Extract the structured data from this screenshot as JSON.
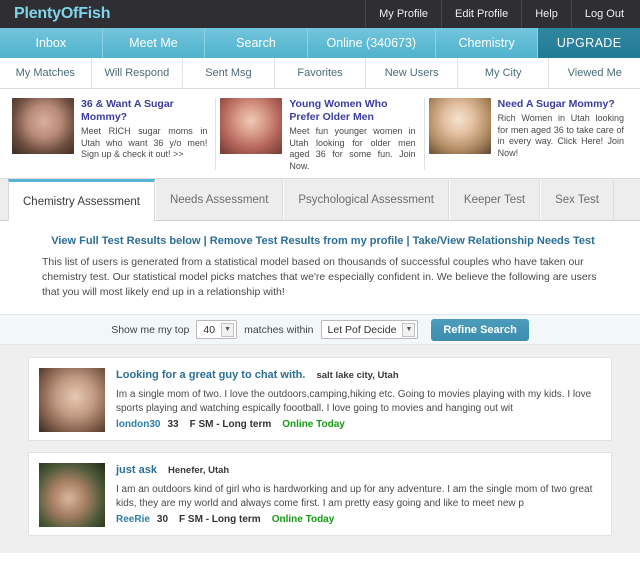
{
  "brand": {
    "name": "PlentyOfFish"
  },
  "topnav": [
    {
      "label": "My Profile"
    },
    {
      "label": "Edit Profile"
    },
    {
      "label": "Help"
    },
    {
      "label": "Log Out"
    }
  ],
  "mainnav": [
    {
      "label": "Inbox"
    },
    {
      "label": "Meet Me"
    },
    {
      "label": "Search"
    },
    {
      "label": "Online (340673)"
    },
    {
      "label": "Chemistry"
    },
    {
      "label": "UPGRADE"
    }
  ],
  "subnav": [
    {
      "label": "My Matches"
    },
    {
      "label": "Will Respond"
    },
    {
      "label": "Sent Msg"
    },
    {
      "label": "Favorites"
    },
    {
      "label": "New Users"
    },
    {
      "label": "My City"
    },
    {
      "label": "Viewed Me"
    }
  ],
  "ads": [
    {
      "title": "36 & Want A Sugar Mommy?",
      "text": "Meet RICH sugar moms in Utah who want 36 y/o men! Sign up & check it out! >>"
    },
    {
      "title": "Young Women Who Prefer Older Men",
      "text": "Meet fun younger women in Utah looking for older men aged 36 for some fun. Join Now."
    },
    {
      "title": "Need A Sugar Mommy?",
      "text": "Rich Women in Utah looking for men aged 36 to take care of in every way. Click Here! Join Now!"
    }
  ],
  "tabs": [
    {
      "label": "Chemistry Assessment",
      "active": true
    },
    {
      "label": "Needs Assessment",
      "active": false
    },
    {
      "label": "Psychological Assessment",
      "active": false
    },
    {
      "label": "Keeper Test",
      "active": false
    },
    {
      "label": "Sex Test",
      "active": false
    }
  ],
  "intro": {
    "link1": "View Full Test Results below",
    "sep1": "|",
    "link2": "Remove Test Results from my profile",
    "sep2": "|",
    "link3": "Take/View Relationship Needs Test",
    "body": "This list of users is generated from a statistical model based on thousands of successful couples who have taken our chemistry test. Our statistical model picks matches that we're especially confident in. We believe the following are users that you will most likely end up in a relationship with!"
  },
  "refine": {
    "label_before": "Show me my top",
    "count_value": "40",
    "label_middle": "matches within",
    "distance_value": "Let Pof Decide",
    "button_label": "Refine Search",
    "arrow_glyph": "▼"
  },
  "results": [
    {
      "headline": "Looking for a great guy to chat with.",
      "location": "salt lake city, Utah",
      "description": "Im a single mom of two. I love the outdoors,camping,hiking etc. Going to movies playing with my kids. I love sports playing and watching espically foootball. I love going to movies and hanging out wit",
      "username": "london30",
      "age": "33",
      "tags": "F SM - Long term",
      "status": "Online Today"
    },
    {
      "headline": "just ask",
      "location": "Henefer, Utah",
      "description": "I am an outdoors kind of girl who is hardworking and up for any adventure. I am the single mom of two great kids, they are my world and always come first. I am pretty easy going and like to meet new p",
      "username": "ReeRie",
      "age": "30",
      "tags": "F SM - Long term",
      "status": "Online Today"
    }
  ],
  "colors": {
    "brand_teal": "#4fb2cd",
    "dark_header": "#2e2e33",
    "upgrade_teal": "#227b96",
    "link_blue": "#2c6f96",
    "ad_title_blue": "#3c3c9e",
    "online_green": "#169b16"
  }
}
